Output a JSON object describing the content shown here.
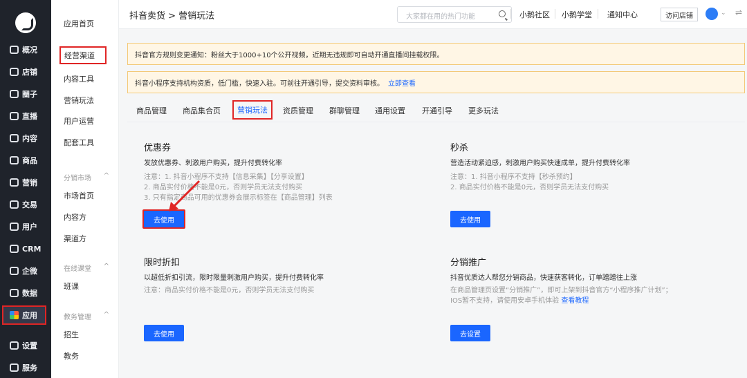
{
  "sidebar": {
    "items": [
      {
        "label": "概况",
        "icon": "overview-icon"
      },
      {
        "label": "店铺",
        "icon": "store-icon"
      },
      {
        "label": "圈子",
        "icon": "circle-icon"
      },
      {
        "label": "直播",
        "icon": "live-icon"
      },
      {
        "label": "内容",
        "icon": "content-icon"
      },
      {
        "label": "商品",
        "icon": "goods-icon"
      },
      {
        "label": "营销",
        "icon": "marketing-icon"
      },
      {
        "label": "交易",
        "icon": "trade-icon"
      },
      {
        "label": "用户",
        "icon": "user-icon"
      },
      {
        "label": "CRM",
        "icon": "crm-icon"
      },
      {
        "label": "企微",
        "icon": "wecom-icon"
      },
      {
        "label": "数据",
        "icon": "data-icon"
      },
      {
        "label": "应用",
        "icon": "app-icon"
      },
      {
        "label": "设置",
        "icon": "settings-icon"
      },
      {
        "label": "服务",
        "icon": "service-icon"
      }
    ]
  },
  "subnav": {
    "items": [
      "应用首页",
      "经营渠道",
      "内容工具",
      "营销玩法",
      "用户运营",
      "配套工具"
    ],
    "group_market": "分销市场",
    "market_items": [
      "市场首页",
      "内容方",
      "渠道方"
    ],
    "group_offline": "在线课堂",
    "offline_items": [
      "班课"
    ],
    "group_edu": "教务管理",
    "edu_items": [
      "招生",
      "教务"
    ]
  },
  "header": {
    "breadcrumb": "抖音卖货 > 营销玩法",
    "search_placeholder": "大家都在用的热门功能",
    "links": [
      "小鹅社区",
      "小鹅学堂",
      "通知中心"
    ],
    "visit_store": "访问店铺"
  },
  "notices": {
    "first": "抖音官方规则变更通知：粉丝大于1000+10个公开视频，近期无违规即可自动开通直播间挂载权限。",
    "second": "抖音小程序支持机构资质，低门槛，快速入驻。可前往开通引导，提交资料审核。",
    "second_link": "立即查看"
  },
  "tabs": [
    "商品管理",
    "商品集合页",
    "营销玩法",
    "资质管理",
    "群聊管理",
    "通用设置",
    "开通引导",
    "更多玩法"
  ],
  "cards": {
    "coupon": {
      "title": "优惠券",
      "desc": "发放优惠券、刺激用户购买，提升付费转化率",
      "notes": [
        "注意：1. 抖音小程序不支持【信息采集】【分享设置】",
        "2. 商品实付价格不能是0元，否则学员无法支付购买",
        "3. 只有指定商品可用的优惠券会展示标签在【商品管理】列表"
      ],
      "button": "去使用"
    },
    "seckill": {
      "title": "秒杀",
      "desc": "营造活动紧迫感，刺激用户购买快速成单，提升付费转化率",
      "notes": [
        "注意：1. 抖音小程序不支持【秒杀预约】",
        "2. 商品实付价格不能是0元，否则学员无法支付购买"
      ],
      "button": "去使用"
    },
    "discount": {
      "title": "限时折扣",
      "desc": "以超低折扣引流，限时限量刺激用户购买，提升付费转化率",
      "notes": [
        "注意：商品实付价格不能是0元，否则学员无法支付购买"
      ],
      "button": "去使用"
    },
    "distribution": {
      "title": "分销推广",
      "desc": "抖音优质达人帮您分销商品，快速获客转化，订单蹭蹭往上涨",
      "notes": [
        "在商品管理页设置“分销推广”，即可上架到抖音官方“小程序推广计划”；",
        "IOS暂不支持，请使用安卓手机体验"
      ],
      "note_link": "查看教程",
      "button": "去设置"
    }
  },
  "colors": {
    "primary": "#1a66ff",
    "highlight": "#e02525",
    "sidebar": "#1f232b"
  }
}
